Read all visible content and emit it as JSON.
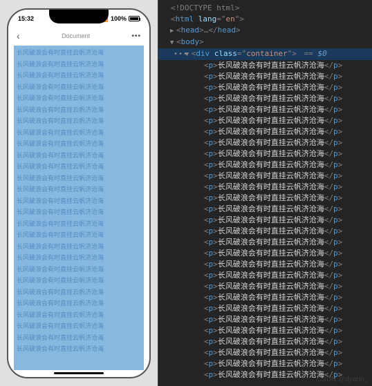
{
  "phone": {
    "status": {
      "time": "15:32",
      "battery_pct": "100%"
    },
    "nav": {
      "title": "Document",
      "more": "•••"
    },
    "line_text": "长风破浪会有时直挂云帆济沧海",
    "line_count": 27
  },
  "devtools": {
    "doctype": "<!DOCTYPE html>",
    "html_open_pre": "<html ",
    "html_attr_name": "lang",
    "html_attr_eq": "=\"",
    "html_attr_val": "en",
    "html_attr_close": "\">",
    "head_open": "<head>",
    "head_ellipsis": "…",
    "head_close": "</head>",
    "body_open": "<body>",
    "container_open_pre": "<div ",
    "container_attr_name": "class",
    "container_attr_eq": "=\"",
    "container_attr_val": "container",
    "container_attr_close": "\">",
    "selected_eq": " == ",
    "selected_var": "$0",
    "p_open": "<p>",
    "p_text": "长风破浪会有时直挂云帆济沧海",
    "p_close": "</p>",
    "p_count": 29,
    "watermark": "CSDN @dyann_"
  }
}
